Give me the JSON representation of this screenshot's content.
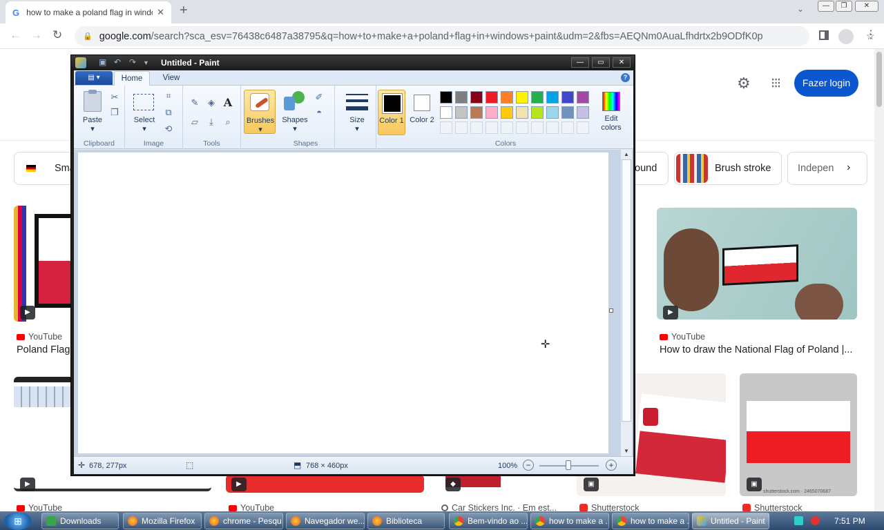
{
  "browser": {
    "tab_title": "how to make a poland flag in windo",
    "tab_icon_letter": "G",
    "url_host": "google.com",
    "url_rest": "/search?sca_esv=76438c6487a38795&q=how+to+make+a+poland+flag+in+windows+paint&udm=2&fbs=AEQNm0AuaLfhdrtx2b9ODfK0pn..."
  },
  "google": {
    "login_label": "Fazer login",
    "chips": [
      "Sma",
      "ound",
      "Brush stroke",
      "Indepen"
    ],
    "results": [
      {
        "source": "YouTube",
        "title": "Poland Flag"
      },
      {
        "source": "YouTube",
        "title": "How to draw the National Flag of Poland |..."
      },
      {
        "source": "YouTube"
      },
      {
        "source": "YouTube"
      },
      {
        "source": "Car Stickers Inc. · Em est..."
      },
      {
        "source": "Shutterstock"
      },
      {
        "source": "Shutterstock"
      }
    ],
    "shutterstock_caption": "shutterstock.com · 2465070687"
  },
  "paint": {
    "window_title": "Untitled - Paint",
    "tabs": {
      "home": "Home",
      "view": "View"
    },
    "groups": {
      "clipboard": "Clipboard",
      "image": "Image",
      "tools": "Tools",
      "shapes": "Shapes",
      "colors": "Colors"
    },
    "buttons": {
      "paste": "Paste",
      "select": "Select",
      "brushes": "Brushes",
      "shapes": "Shapes",
      "size": "Size",
      "color1": "Color 1",
      "color2": "Color 2",
      "edit_colors": "Edit colors"
    },
    "color1_value": "#000000",
    "color2_value": "#ffffff",
    "palette": [
      "#000000",
      "#7f7f7f",
      "#880015",
      "#ed1c24",
      "#ff7f27",
      "#fff200",
      "#22b14c",
      "#00a2e8",
      "#3f48cc",
      "#a349a4",
      "#ffffff",
      "#c3c3c3",
      "#b97a57",
      "#ffaec9",
      "#ffc90e",
      "#efe4b0",
      "#b5e61d",
      "#99d9ea",
      "#7092be",
      "#c8bfe7"
    ],
    "status": {
      "coords": "678, 277px",
      "dimensions": "768 × 460px",
      "zoom": "100%"
    }
  },
  "taskbar": {
    "items": [
      {
        "label": "Downloads",
        "icon": "downloads-icon"
      },
      {
        "label": "Mozilla Firefox",
        "icon": "firefox-icon"
      },
      {
        "label": "chrome - Pesqu...",
        "icon": "firefox-icon"
      },
      {
        "label": "Navegador we...",
        "icon": "firefox-icon"
      },
      {
        "label": "Biblioteca",
        "icon": "firefox-icon"
      },
      {
        "label": "Bem-vindo ao ...",
        "icon": "chrome-icon"
      },
      {
        "label": "how to make a ...",
        "icon": "chrome-icon"
      },
      {
        "label": "how to make a ...",
        "icon": "chrome-icon"
      },
      {
        "label": "Untitled - Paint",
        "icon": "paint-icon"
      }
    ],
    "clock": "7:51 PM"
  }
}
